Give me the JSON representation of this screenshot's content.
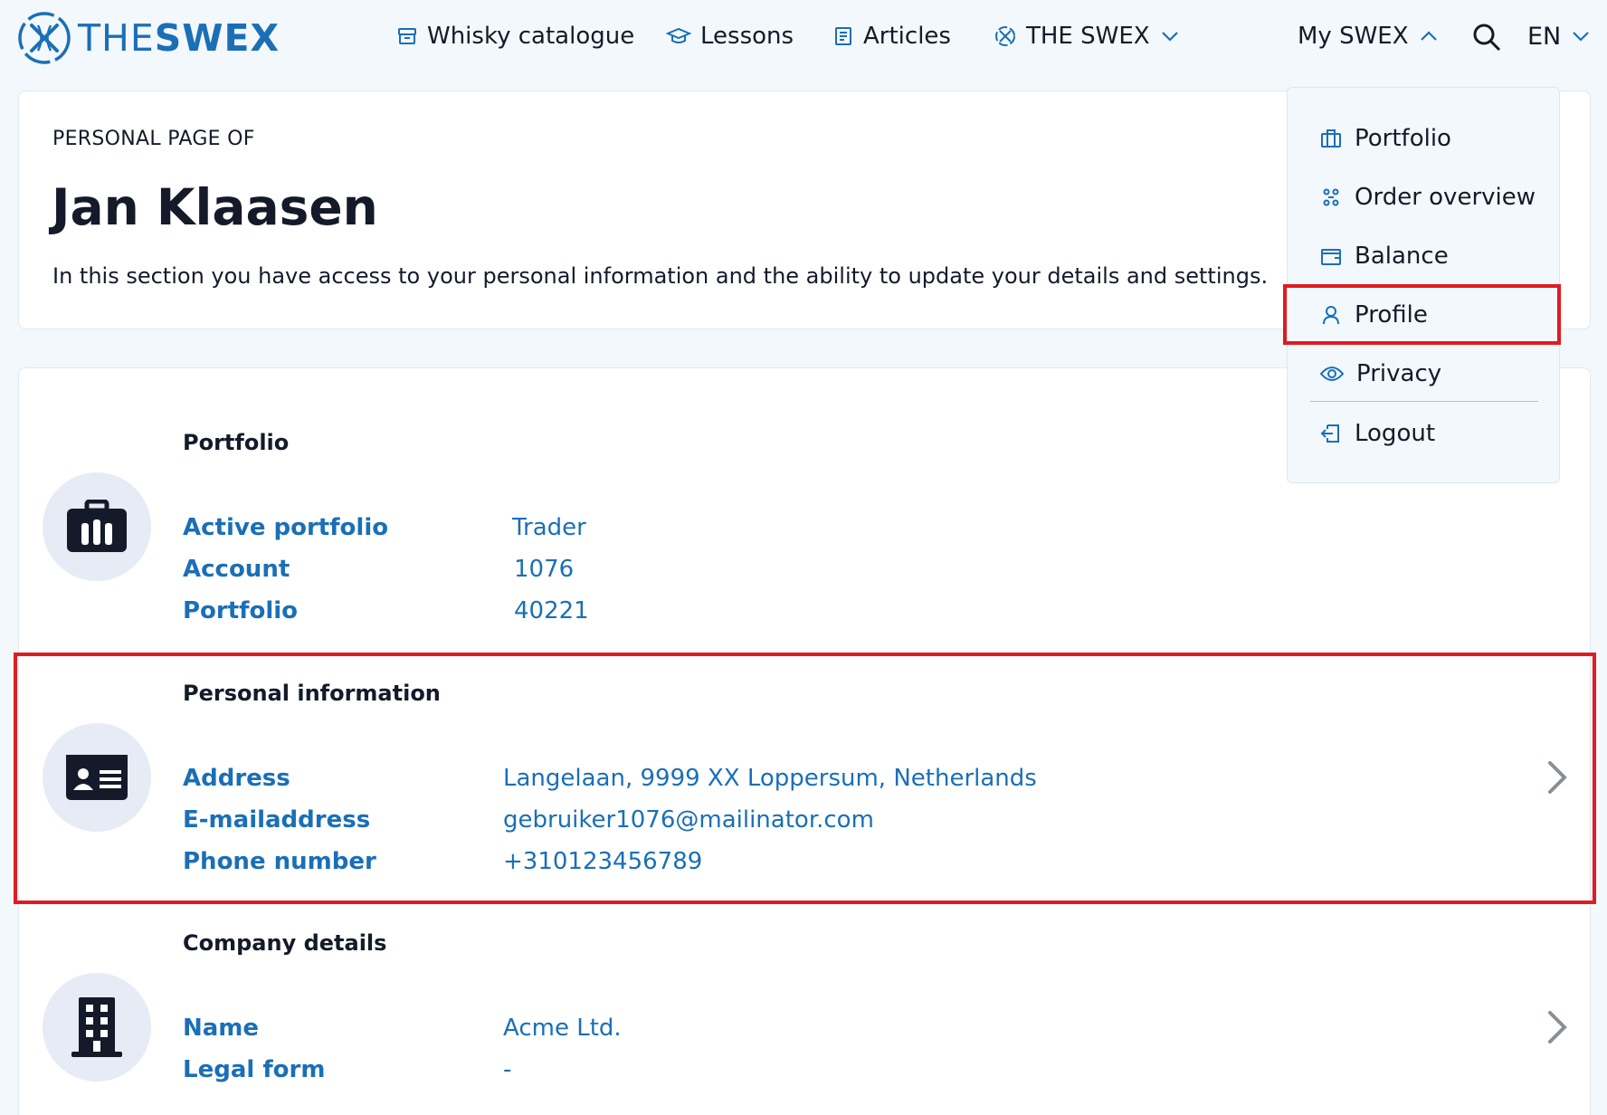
{
  "brand": {
    "prefix": "THE",
    "name": "SWEX"
  },
  "nav": {
    "whisky": "Whisky catalogue",
    "lessons": "Lessons",
    "articles": "Articles",
    "theswex": "THE SWEX",
    "myswex": "My SWEX",
    "lang": "EN"
  },
  "intro": {
    "eyebrow": "PERSONAL PAGE OF",
    "name": "Jan Klaasen",
    "description": "In this section you have access to your personal information and the ability to update your details and settings."
  },
  "portfolio": {
    "title": "Portfolio",
    "rows": [
      {
        "label": "Active portfolio",
        "value": "Trader"
      },
      {
        "label": "Account",
        "value": "1076"
      },
      {
        "label": "Portfolio",
        "value": "40221"
      }
    ]
  },
  "personal": {
    "title": "Personal information",
    "rows": [
      {
        "label": "Address",
        "value": "Langelaan, 9999 XX Loppersum, Netherlands"
      },
      {
        "label": "E-mailaddress",
        "value": "gebruiker1076@mailinator.com"
      },
      {
        "label": "Phone number",
        "value": "+310123456789"
      }
    ]
  },
  "company": {
    "title": "Company details",
    "rows": [
      {
        "label": "Name",
        "value": "Acme Ltd."
      },
      {
        "label": "Legal form",
        "value": "-"
      }
    ]
  },
  "dropdown": {
    "items": [
      {
        "label": "Portfolio",
        "icon": "briefcase-icon"
      },
      {
        "label": "Order overview",
        "icon": "order-icon"
      },
      {
        "label": "Balance",
        "icon": "wallet-icon"
      },
      {
        "label": "Profile",
        "icon": "user-icon"
      },
      {
        "label": "Privacy",
        "icon": "eye-icon"
      },
      {
        "label": "Logout",
        "icon": "logout-icon"
      }
    ]
  },
  "colors": {
    "accent": "#1a6fb7",
    "highlight": "#e01b22",
    "icon_bg": "#e6ebf5"
  }
}
